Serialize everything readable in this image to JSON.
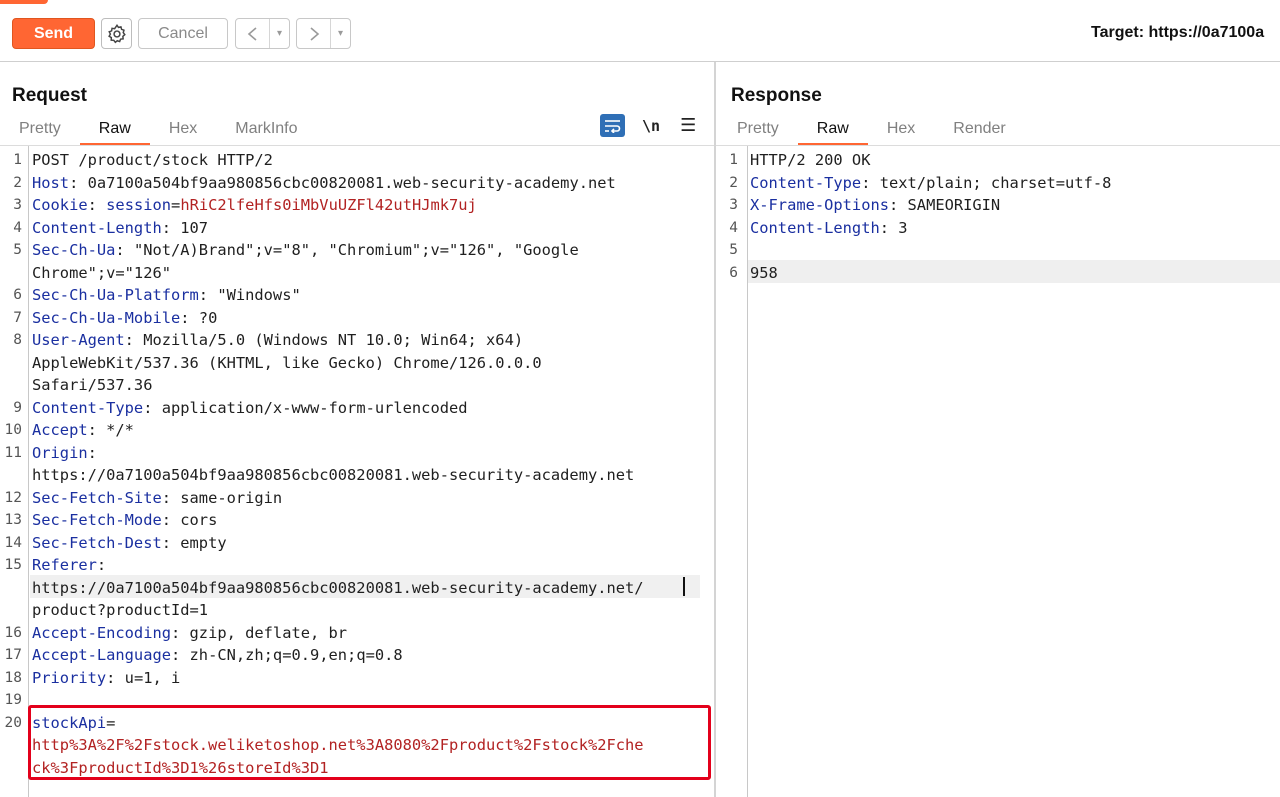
{
  "toolbar": {
    "send_label": "Send",
    "settings_icon": "gear-icon",
    "cancel_label": "Cancel",
    "back_icon": "<",
    "forward_icon": ">",
    "dropdown_icon": "▾",
    "target_text": "Target: https://0a7100a"
  },
  "request": {
    "title": "Request",
    "tabs": [
      "Pretty",
      "Raw",
      "Hex",
      "MarkInfo"
    ],
    "active_tab": "Raw",
    "icons": {
      "wrap": "word-wrap-icon",
      "newline": "\\n",
      "menu": "☰"
    },
    "lines": [
      {
        "n": "1",
        "parts": [
          {
            "t": "POST /product/stock HTTP/2",
            "c": "plain"
          }
        ]
      },
      {
        "n": "2",
        "parts": [
          {
            "t": "Host",
            "c": "hname"
          },
          {
            "t": ": 0a7100a504bf9aa980856cbc00820081.web-security-academy.net",
            "c": "plain"
          }
        ]
      },
      {
        "n": "3",
        "parts": [
          {
            "t": "Cookie",
            "c": "hname"
          },
          {
            "t": ": ",
            "c": "plain"
          },
          {
            "t": "session",
            "c": "cookie-name"
          },
          {
            "t": "=",
            "c": "plain"
          },
          {
            "t": "hRiC2lfeHfs0iMbVuUZFl42utHJmk7uj",
            "c": "cookie-val"
          }
        ]
      },
      {
        "n": "4",
        "parts": [
          {
            "t": "Content-Length",
            "c": "hname"
          },
          {
            "t": ": 107",
            "c": "plain"
          }
        ]
      },
      {
        "n": "5",
        "parts": [
          {
            "t": "Sec-Ch-Ua",
            "c": "hname"
          },
          {
            "t": ": \"Not/A)Brand\";v=\"8\", \"Chromium\";v=\"126\", \"Google",
            "c": "plain"
          }
        ]
      },
      {
        "n": "",
        "parts": [
          {
            "t": "Chrome\";v=\"126\"",
            "c": "plain"
          }
        ]
      },
      {
        "n": "6",
        "parts": [
          {
            "t": "Sec-Ch-Ua-Platform",
            "c": "hname"
          },
          {
            "t": ": \"Windows\"",
            "c": "plain"
          }
        ]
      },
      {
        "n": "7",
        "parts": [
          {
            "t": "Sec-Ch-Ua-Mobile",
            "c": "hname"
          },
          {
            "t": ": ?0",
            "c": "plain"
          }
        ]
      },
      {
        "n": "8",
        "parts": [
          {
            "t": "User-Agent",
            "c": "hname"
          },
          {
            "t": ": Mozilla/5.0 (Windows NT 10.0; Win64; x64)",
            "c": "plain"
          }
        ]
      },
      {
        "n": "",
        "parts": [
          {
            "t": "AppleWebKit/537.36 (KHTML, like Gecko) Chrome/126.0.0.0",
            "c": "plain"
          }
        ]
      },
      {
        "n": "",
        "parts": [
          {
            "t": "Safari/537.36",
            "c": "plain"
          }
        ]
      },
      {
        "n": "9",
        "parts": [
          {
            "t": "Content-Type",
            "c": "hname"
          },
          {
            "t": ": application/x-www-form-urlencoded",
            "c": "plain"
          }
        ]
      },
      {
        "n": "10",
        "parts": [
          {
            "t": "Accept",
            "c": "hname"
          },
          {
            "t": ": */*",
            "c": "plain"
          }
        ]
      },
      {
        "n": "11",
        "parts": [
          {
            "t": "Origin",
            "c": "hname"
          },
          {
            "t": ":",
            "c": "plain"
          }
        ]
      },
      {
        "n": "",
        "parts": [
          {
            "t": "https://0a7100a504bf9aa980856cbc00820081.web-security-academy.net",
            "c": "plain"
          }
        ]
      },
      {
        "n": "12",
        "parts": [
          {
            "t": "Sec-Fetch-Site",
            "c": "hname"
          },
          {
            "t": ": same-origin",
            "c": "plain"
          }
        ]
      },
      {
        "n": "13",
        "parts": [
          {
            "t": "Sec-Fetch-Mode",
            "c": "hname"
          },
          {
            "t": ": cors",
            "c": "plain"
          }
        ]
      },
      {
        "n": "14",
        "parts": [
          {
            "t": "Sec-Fetch-Dest",
            "c": "hname"
          },
          {
            "t": ": empty",
            "c": "plain"
          }
        ]
      },
      {
        "n": "15",
        "parts": [
          {
            "t": "Referer",
            "c": "hname"
          },
          {
            "t": ":",
            "c": "plain"
          }
        ]
      },
      {
        "n": "",
        "parts": [
          {
            "t": "https://0a7100a504bf9aa980856cbc00820081.web-security-academy.net/",
            "c": "plain"
          }
        ]
      },
      {
        "n": "",
        "parts": [
          {
            "t": "product?productId=1",
            "c": "plain"
          }
        ]
      },
      {
        "n": "16",
        "parts": [
          {
            "t": "Accept-Encoding",
            "c": "hname"
          },
          {
            "t": ": gzip, deflate, br",
            "c": "plain"
          }
        ]
      },
      {
        "n": "17",
        "parts": [
          {
            "t": "Accept-Language",
            "c": "hname"
          },
          {
            "t": ": zh-CN,zh;q=0.9,en;q=0.8",
            "c": "plain"
          }
        ]
      },
      {
        "n": "18",
        "parts": [
          {
            "t": "Priority",
            "c": "hname"
          },
          {
            "t": ": u=1, i",
            "c": "plain"
          }
        ]
      },
      {
        "n": "19",
        "parts": []
      },
      {
        "n": "20",
        "parts": [
          {
            "t": "stockApi",
            "c": "hname"
          },
          {
            "t": "=",
            "c": "plain"
          }
        ]
      },
      {
        "n": "",
        "parts": [
          {
            "t": "http%3A%2F%2Fstock.weliketoshop.net%3A8080%2Fproduct%2Fstock%2Fche",
            "c": "param-val"
          }
        ]
      },
      {
        "n": "",
        "parts": [
          {
            "t": "ck%3FproductId%3D1%26storeId%3D1",
            "c": "param-val"
          }
        ]
      }
    ]
  },
  "response": {
    "title": "Response",
    "tabs": [
      "Pretty",
      "Raw",
      "Hex",
      "Render"
    ],
    "active_tab": "Raw",
    "lines": [
      {
        "n": "1",
        "parts": [
          {
            "t": "HTTP/2 200 OK",
            "c": "plain"
          }
        ]
      },
      {
        "n": "2",
        "parts": [
          {
            "t": "Content-Type",
            "c": "hname"
          },
          {
            "t": ": text/plain; charset=utf-8",
            "c": "plain"
          }
        ]
      },
      {
        "n": "3",
        "parts": [
          {
            "t": "X-Frame-Options",
            "c": "hname"
          },
          {
            "t": ": SAMEORIGIN",
            "c": "plain"
          }
        ]
      },
      {
        "n": "4",
        "parts": [
          {
            "t": "Content-Length",
            "c": "hname"
          },
          {
            "t": ": 3",
            "c": "plain"
          }
        ]
      },
      {
        "n": "5",
        "parts": []
      },
      {
        "n": "6",
        "parts": [
          {
            "t": "958",
            "c": "plain"
          }
        ]
      }
    ]
  },
  "colors": {
    "accent": "#ff6633",
    "header_name": "#1a2fa0",
    "value_red": "#b22222",
    "highlight_box": "#e3001b"
  }
}
